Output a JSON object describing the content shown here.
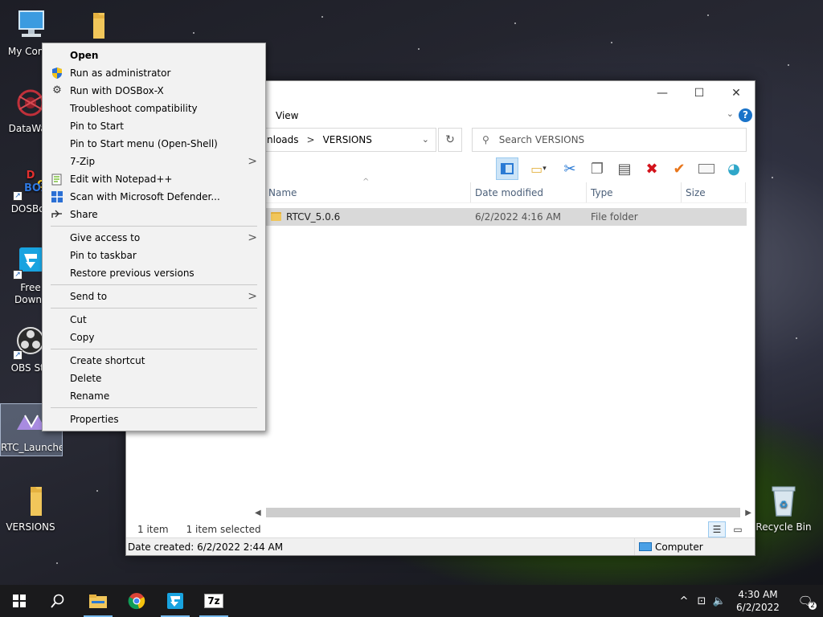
{
  "desktop": {
    "icons": [
      {
        "label": "My Comp"
      },
      {
        "label": ""
      },
      {
        "label": "DataWag"
      },
      {
        "label": "DOSBox"
      },
      {
        "label": "Free Downlo"
      },
      {
        "label": "OBS Stu"
      },
      {
        "label": "RTC_Launcher"
      },
      {
        "label": "VERSIONS"
      },
      {
        "label": "Recycle Bin"
      }
    ]
  },
  "context_menu": {
    "items": [
      {
        "label": "Open"
      },
      {
        "label": "Run as administrator",
        "icon": "shield-icon"
      },
      {
        "label": "Run with DOSBox-X",
        "icon": "dosbox-icon"
      },
      {
        "label": "Troubleshoot compatibility"
      },
      {
        "label": "Pin to Start"
      },
      {
        "label": "Pin to Start menu (Open-Shell)"
      },
      {
        "label": "7-Zip"
      },
      {
        "label": "Edit with Notepad++",
        "icon": "notepad-icon"
      },
      {
        "label": "Scan with Microsoft Defender...",
        "icon": "defender-icon"
      },
      {
        "label": "Share",
        "icon": "share-icon"
      },
      {
        "label": "Give access to"
      },
      {
        "label": "Pin to taskbar"
      },
      {
        "label": "Restore previous versions"
      },
      {
        "label": "Send to"
      },
      {
        "label": "Cut"
      },
      {
        "label": "Copy"
      },
      {
        "label": "Create shortcut"
      },
      {
        "label": "Delete"
      },
      {
        "label": "Rename"
      },
      {
        "label": "Properties"
      }
    ]
  },
  "explorer": {
    "ribbon_tab": "View",
    "address": {
      "part1": "nloads",
      "separator": ">",
      "part2": "VERSIONS"
    },
    "search_placeholder": "Search VERSIONS",
    "columns": [
      "Name",
      "Date modified",
      "Type",
      "Size"
    ],
    "files": [
      {
        "name": "RTCV_5.0.6",
        "date": "6/2/2022 4:16 AM",
        "type": "File folder",
        "size": ""
      }
    ],
    "status": {
      "count": "1 item",
      "selected": "1 item selected"
    },
    "details": {
      "created": "Date created: 6/2/2022 2:44 AM",
      "location": "Computer"
    }
  },
  "taskbar": {
    "time": "4:30 AM",
    "date": "6/2/2022",
    "notifications": "2",
    "zip_label": "7z"
  }
}
